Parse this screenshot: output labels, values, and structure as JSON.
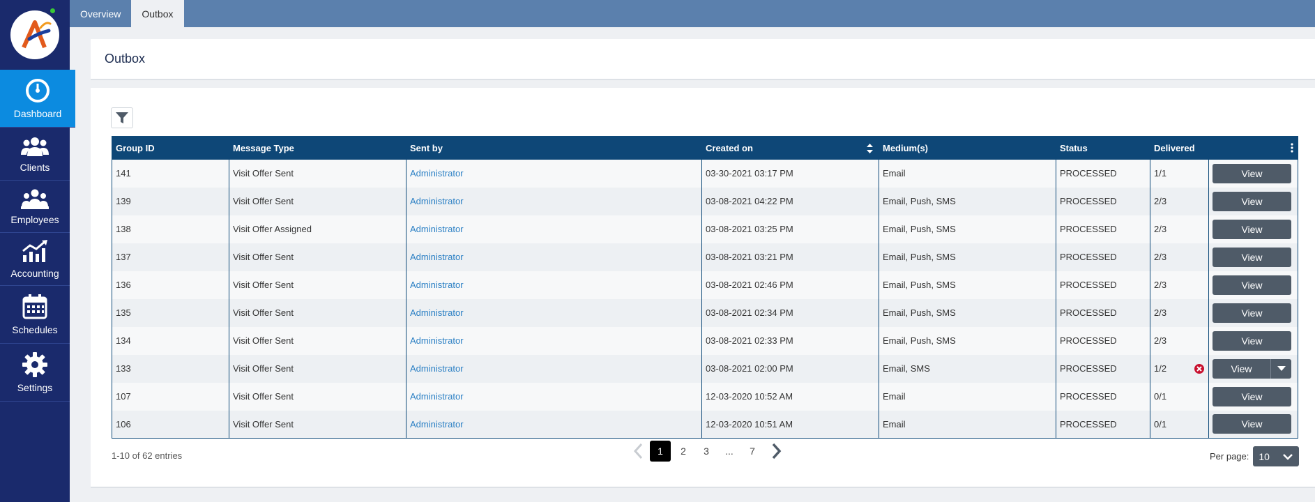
{
  "sidebar": {
    "logo_text": "A",
    "items": [
      {
        "label": "Dashboard",
        "icon": "gauge-icon",
        "active": true
      },
      {
        "label": "Clients",
        "icon": "users-icon"
      },
      {
        "label": "Employees",
        "icon": "employees-icon"
      },
      {
        "label": "Accounting",
        "icon": "chart-icon"
      },
      {
        "label": "Schedules",
        "icon": "calendar-icon"
      },
      {
        "label": "Settings",
        "icon": "gear-icon"
      }
    ]
  },
  "tabs": [
    {
      "label": "Overview",
      "active": false
    },
    {
      "label": "Outbox",
      "active": true
    }
  ],
  "page": {
    "title": "Outbox"
  },
  "table": {
    "headers": [
      "Group ID",
      "Message Type",
      "Sent by",
      "Created on",
      "Medium(s)",
      "Status",
      "Delivered"
    ],
    "view_label": "View",
    "rows": [
      {
        "id": "141",
        "type": "Visit Offer Sent",
        "sent_by": "Administrator",
        "created": "03-30-2021 03:17 PM",
        "medium": "Email",
        "status": "PROCESSED",
        "delivered": "1/1"
      },
      {
        "id": "139",
        "type": "Visit Offer Sent",
        "sent_by": "Administrator",
        "created": "03-08-2021 04:22 PM",
        "medium": "Email, Push, SMS",
        "status": "PROCESSED",
        "delivered": "2/3"
      },
      {
        "id": "138",
        "type": "Visit Offer Assigned",
        "sent_by": "Administrator",
        "created": "03-08-2021 03:25 PM",
        "medium": "Email, Push, SMS",
        "status": "PROCESSED",
        "delivered": "2/3"
      },
      {
        "id": "137",
        "type": "Visit Offer Sent",
        "sent_by": "Administrator",
        "created": "03-08-2021 03:21 PM",
        "medium": "Email, Push, SMS",
        "status": "PROCESSED",
        "delivered": "2/3"
      },
      {
        "id": "136",
        "type": "Visit Offer Sent",
        "sent_by": "Administrator",
        "created": "03-08-2021 02:46 PM",
        "medium": "Email, Push, SMS",
        "status": "PROCESSED",
        "delivered": "2/3"
      },
      {
        "id": "135",
        "type": "Visit Offer Sent",
        "sent_by": "Administrator",
        "created": "03-08-2021 02:34 PM",
        "medium": "Email, Push, SMS",
        "status": "PROCESSED",
        "delivered": "2/3"
      },
      {
        "id": "134",
        "type": "Visit Offer Sent",
        "sent_by": "Administrator",
        "created": "03-08-2021 02:33 PM",
        "medium": "Email, Push, SMS",
        "status": "PROCESSED",
        "delivered": "2/3"
      },
      {
        "id": "133",
        "type": "Visit Offer Sent",
        "sent_by": "Administrator",
        "created": "03-08-2021 02:00 PM",
        "medium": "Email, SMS",
        "status": "PROCESSED",
        "delivered": "1/2",
        "error": true
      },
      {
        "id": "107",
        "type": "Visit Offer Sent",
        "sent_by": "Administrator",
        "created": "12-03-2020 10:52 AM",
        "medium": "Email",
        "status": "PROCESSED",
        "delivered": "0/1"
      },
      {
        "id": "106",
        "type": "Visit Offer Sent",
        "sent_by": "Administrator",
        "created": "12-03-2020 10:51 AM",
        "medium": "Email",
        "status": "PROCESSED",
        "delivered": "0/1"
      }
    ]
  },
  "footer": {
    "entries": "1-10 of 62 entries",
    "pages": [
      "1",
      "2",
      "3",
      "...",
      "7"
    ],
    "current_page": "1",
    "per_page_label": "Per page:",
    "per_page_value": "10"
  },
  "colors": {
    "sidebar": "#1a2a6c",
    "active": "#0c8be0",
    "header": "#0e4777",
    "button": "#4f5b68"
  }
}
